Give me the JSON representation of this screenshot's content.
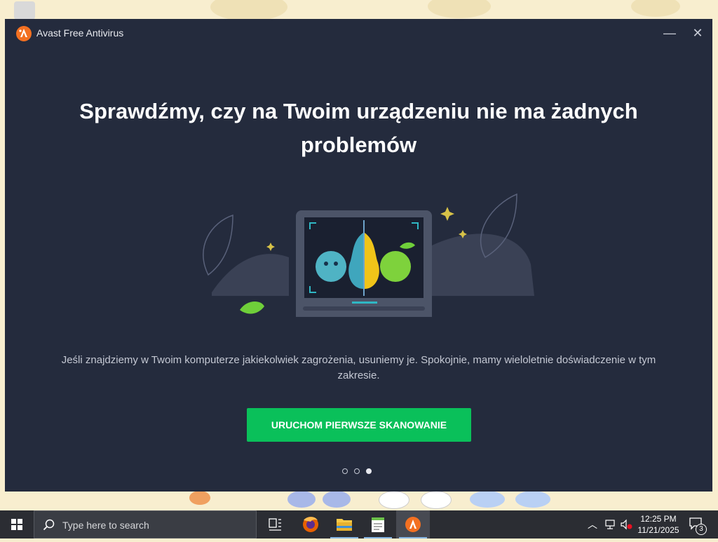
{
  "window": {
    "title": "Avast Free Antivirus",
    "minimize_glyph": "—",
    "close_glyph": "✕"
  },
  "onboarding": {
    "headline": "Sprawdźmy, czy na Twoim urządzeniu nie ma żadnych problemów",
    "description": "Jeśli znajdziemy w Twoim komputerze jakiekolwiek zagrożenia, usuniemy je. Spokojnie, mamy wieloletnie doświadczenie w tym zakresie.",
    "scan_button": "URUCHOM PIERWSZE SKANOWANIE",
    "pager": {
      "pages": 3,
      "active": 3
    }
  },
  "taskbar": {
    "search_placeholder": "Type here to search",
    "apps": [
      "task-view",
      "firefox",
      "file-explorer",
      "notepad-app",
      "avast"
    ],
    "clock_time": "12:25 PM",
    "clock_date": "11/21/2025",
    "notification_count": "3"
  },
  "colors": {
    "window_bg": "#242b3d",
    "accent_green": "#0ac05a",
    "avast_orange": "#f37021",
    "taskbar_bg": "#2b2d33"
  }
}
